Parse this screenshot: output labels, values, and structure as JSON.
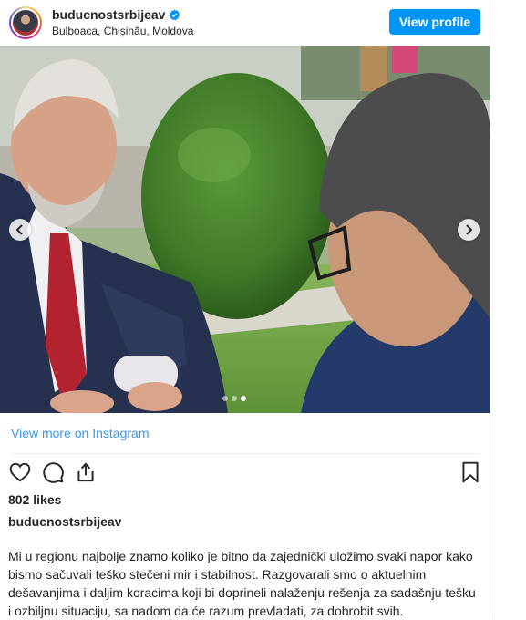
{
  "header": {
    "username": "buducnostsrbijeav",
    "location": "Bulboaca, Chișinău, Moldova",
    "view_profile_label": "View profile",
    "verified_icon": "verified-badge-icon"
  },
  "carousel": {
    "slide_count": 3,
    "active_slide": 3
  },
  "view_more_label": "View more on Instagram",
  "actions": {
    "like_icon": "heart-icon",
    "comment_icon": "comment-icon",
    "share_icon": "share-icon",
    "save_icon": "bookmark-icon"
  },
  "likes": "802 likes",
  "caption": {
    "username": "buducnostsrbijeav",
    "text": "Mi u regionu najbolje znamo koliko je bitno da zajednički uložimo svaki napor kako bismo sačuvali teško stečeni mir i stabilnost. Razgovarali smo o aktuelnim dešavanjima i daljim koracima koji bi doprineli nalaženju rešenja za sadašnju tešku i ozbiljnu situaciju, sa nadom da će razum prevladati, za dobrobit svih."
  },
  "colors": {
    "accent": "#0095f6",
    "link": "#3897f0",
    "text": "#262626"
  }
}
